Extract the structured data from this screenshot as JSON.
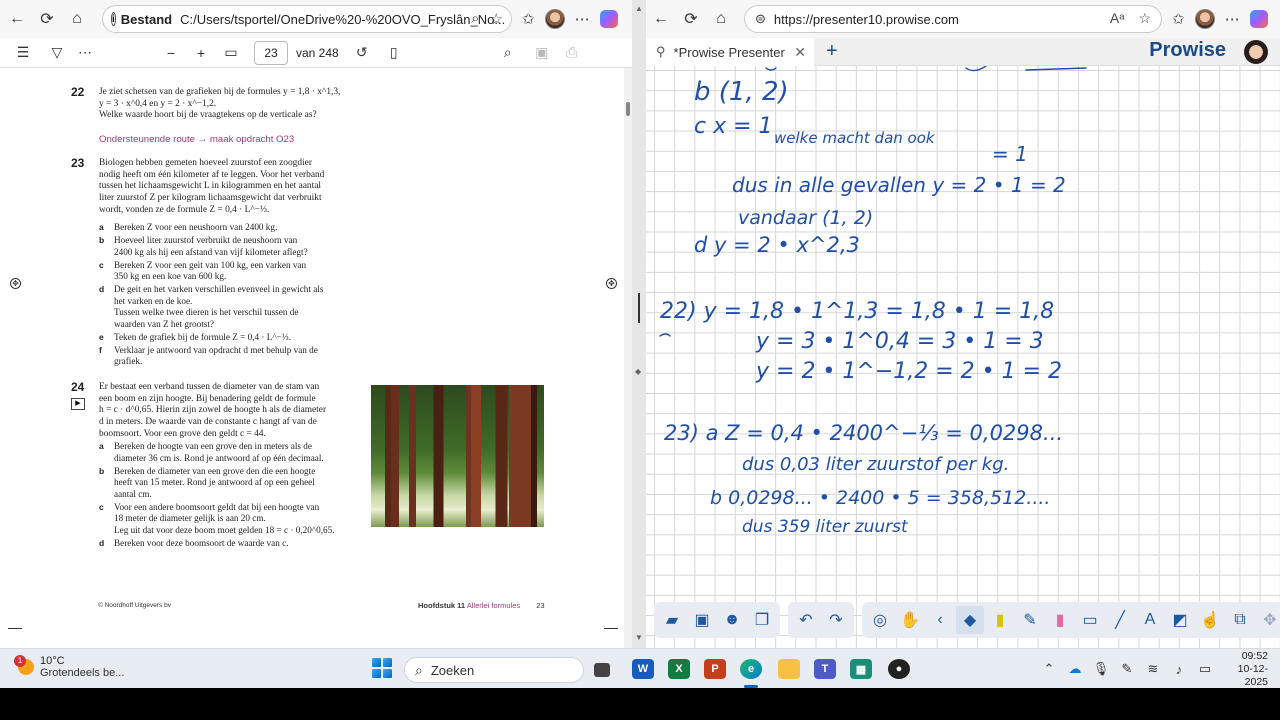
{
  "left_browser": {
    "site_label": "Bestand",
    "url": "C:/Users/tsportel/OneDrive%20-%20OVO_Fryslân_No...",
    "page_current": "23",
    "page_total": "van 248"
  },
  "pdf": {
    "q22": {
      "num": "22",
      "line1": "Je ziet schetsen van de grafieken bij de formules y = 1,8 · x^1,3,",
      "line2": "y = 3 · x^0,4 en y = 2 · x^−1,2.",
      "line3": "Welke waarde hoort bij de vraagtekens op de verticale as?"
    },
    "route": "Ondersteunende route → maak opdracht O23",
    "q23": {
      "num": "23",
      "intro": [
        "Biologen hebben gemeten hoeveel zuurstof een zoogdier",
        "nodig heeft om één kilometer af te leggen. Voor het verband",
        "tussen het lichaamsgewicht L in kilogrammen en het aantal",
        "liter zuurstof Z per kilogram lichaamsgewicht dat verbruikt",
        "wordt, vonden ze de formule Z = 0,4 · L^−⅓."
      ],
      "items": [
        {
          "k": "a",
          "lines": [
            "Bereken Z voor een neushoorn van 2400 kg."
          ]
        },
        {
          "k": "b",
          "lines": [
            "Hoeveel liter zuurstof verbruikt de neushoorn van",
            "2400 kg als hij een afstand van vijf kilometer aflegt?"
          ]
        },
        {
          "k": "c",
          "lines": [
            "Bereken Z voor een geit van 100 kg, een varken van",
            "350 kg en een koe van 600 kg."
          ]
        },
        {
          "k": "d",
          "lines": [
            "De geit en het varken verschillen evenveel in gewicht als",
            "het varken en de koe.",
            "Tussen welke twee dieren is het verschil tussen de",
            "waarden van Z het grootst?"
          ]
        },
        {
          "k": "e",
          "lines": [
            "Teken de grafiek bij de formule Z = 0,4 · L^−⅓."
          ]
        },
        {
          "k": "f",
          "lines": [
            "Verklaar je antwoord van opdracht d met behulp van de",
            "grafiek."
          ]
        }
      ]
    },
    "q24": {
      "num": "24",
      "intro": [
        "Er bestaat een verband tussen de diameter van de stam van",
        "een boom en zijn hoogte. Bij benadering geldt de formule",
        "h = c · d^0,65. Hierin zijn zowel de hoogte h als de diameter",
        "d in meters. De waarde van de constante c hangt af van de",
        "boomsoort. Voor een grove den geldt c = 44."
      ],
      "items": [
        {
          "k": "a",
          "lines": [
            "Bereken de hoogte van een grove den in meters als de",
            "diameter 36 cm is. Rond je antwoord af op één decimaal."
          ]
        },
        {
          "k": "b",
          "lines": [
            "Bereken de diameter van een grove den die een hoogte",
            "heeft van 15 meter. Rond je antwoord af op een geheel",
            "aantal cm."
          ]
        },
        {
          "k": "c",
          "lines": [
            "Voor een andere boomsoort geldt dat bij een hoogte van",
            "18 meter de diameter gelijk is aan 20 cm.",
            "Leg uit dat voor deze boom moet gelden 18 = c · 0,20^0,65."
          ]
        },
        {
          "k": "d",
          "lines": [
            "Bereken voor deze boomsoort de waarde van c."
          ]
        }
      ]
    },
    "footer_left": "© Noordhoff Uitgevers bv",
    "footer_chapter": "Hoofdstuk 11",
    "footer_title": "Allerlei formules",
    "footer_page": "23"
  },
  "right_browser": {
    "url": "https://presenter10.prowise.com",
    "tab_title": "*Prowise Presenter",
    "brand": "Prowise"
  },
  "whiteboard": {
    "lines": [
      "b   (1, 2)",
      "c   x = 1",
      "welke macht dan ook",
      "= 1",
      "dus in alle gevallen     y = 2 • 1 = 2",
      "vandaar (1, 2)",
      "d  y = 2 • x^2,3",
      "22)   y = 1,8 • 1^1,3 = 1,8 • 1 = 1,8",
      "y = 3 • 1^0,4 = 3 • 1 = 3",
      "y = 2 • 1^−1,2 = 2 • 1 = 2",
      "23) a  Z = 0,4 • 2400^−⅓ = 0,0298...",
      "dus 0,03 liter zuurstof per kg.",
      "b  0,0298... • 2400 • 5 = 358,512....",
      "dus 359 liter zuurst"
    ]
  },
  "taskbar": {
    "weather_temp": "10°C",
    "weather_desc": "Grotendeels be...",
    "weather_badge": "1",
    "search_placeholder": "Zoeken",
    "time": "09:52",
    "date": "10-12-2025"
  },
  "colors": {
    "ink": "#1f4fa8",
    "route": "#a0397d",
    "brand": "#1b4a86",
    "toolbar_icon": "#1e5aa0"
  }
}
